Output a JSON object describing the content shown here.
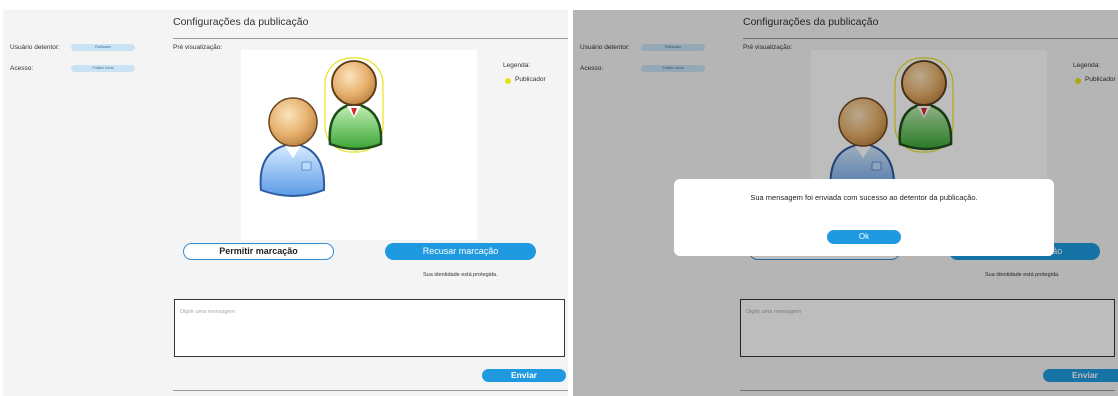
{
  "header": {
    "title": "Configurações da publicação"
  },
  "sidebar": {
    "owner_label": "Usuário detentor:",
    "owner_value": "Publicador",
    "access_label": "Acesso:",
    "access_value": "Publico Geral"
  },
  "preview": {
    "label": "Pré visualização:",
    "legend_title": "Legenda:",
    "legend_item": "Publicador",
    "legend_color": "#e8e21a"
  },
  "actions": {
    "allow_label": "Permitir marcação",
    "refuse_label": "Recusar marcação",
    "identity_note": "Sua identidade está protegida."
  },
  "message": {
    "placeholder": "Digite uma mensagem",
    "send_label": "Enviar"
  },
  "dialog": {
    "text": "Sua mensagem foi enviada com sucesso ao detentor da publicação.",
    "ok_label": "Ok"
  },
  "colors": {
    "accent": "#1f9ae0",
    "panel_bg": "#f4f4f4",
    "overlay": "rgba(0,0,0,0.26)"
  },
  "icons": [
    "user-blue-icon",
    "user-green-icon"
  ]
}
